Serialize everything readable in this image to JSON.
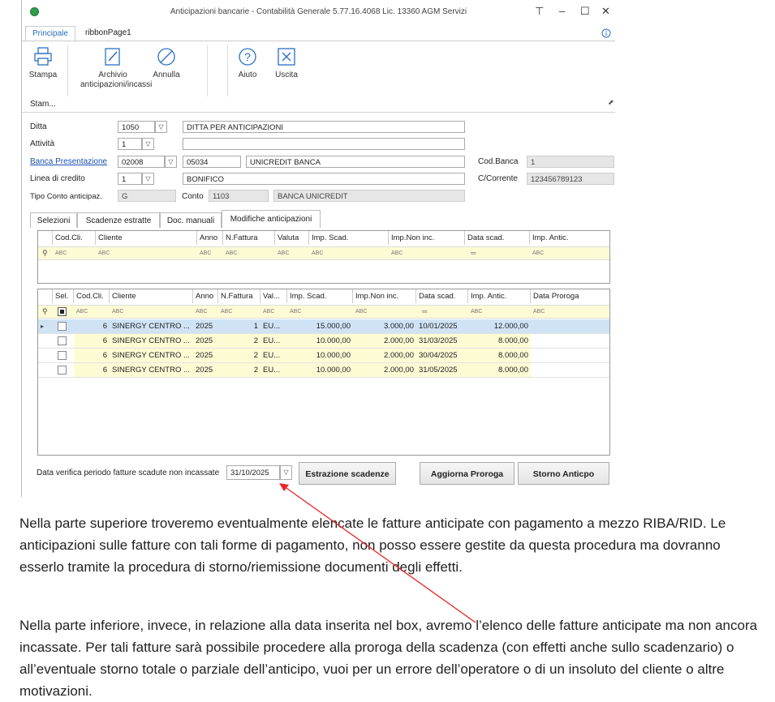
{
  "window": {
    "title": "Anticipazioni bancarie - Contabilità Generale 5.77.16.4068 Lic. 13360 AGM Servizi"
  },
  "ribbon": {
    "tabs": [
      {
        "label": "Principale"
      },
      {
        "label": "ribbonPage1"
      }
    ],
    "buttons": {
      "stampa": "Stampa",
      "archivio": "Archivio anticipazioni/incassi",
      "annulla": "Annulla",
      "aiuto": "Aiuto",
      "uscita": "Uscita"
    },
    "group_label": "Stam..."
  },
  "form": {
    "ditta": {
      "label": "Ditta",
      "code": "1050",
      "name": "DITTA PER ANTICIPAZIONI"
    },
    "attivita": {
      "label": "Attività",
      "value": "1"
    },
    "banca": {
      "label": "Banca Presentazione",
      "code": "02008",
      "cab": "05034",
      "name": "UNICREDIT BANCA"
    },
    "cod_banca": {
      "label": "Cod.Banca",
      "value": "1"
    },
    "linea": {
      "label": "Linea di credito",
      "value": "1",
      "desc": "BONIFICO"
    },
    "c_corrente": {
      "label": "C/Corrente",
      "value": "123456789123"
    },
    "tipo_conto": {
      "label": "Tipo Conto anticipaz.",
      "value": "G"
    },
    "conto": {
      "label": "Conto",
      "code": "1103",
      "desc": "BANCA UNICREDIT"
    }
  },
  "panel_tabs": [
    {
      "label": "Selezioni"
    },
    {
      "label": "Scadenze estratte"
    },
    {
      "label": "Doc. manuali"
    },
    {
      "label": "Modifiche anticipazioni"
    }
  ],
  "filter_glyph": "ABC",
  "top_grid": {
    "columns": [
      "Cod.Cli.",
      "Cliente",
      "Anno",
      "N.Fattura",
      "Valuta",
      "Imp. Scad.",
      "Imp.Non inc.",
      "Data scad.",
      "Imp. Antic."
    ]
  },
  "bottom_grid": {
    "columns": [
      "Sel.",
      "Cod.Cli.",
      "Cliente",
      "Anno",
      "N.Fattura",
      "Val...",
      "Imp. Scad.",
      "Imp.Non inc.",
      "Data scad.",
      "Imp. Antic.",
      "Data Proroga"
    ],
    "rows": [
      {
        "cod": "6",
        "cliente": "SINERGY CENTRO ...",
        "anno": "2025",
        "nfatt": "1",
        "val": "EU...",
        "imp": "15.000,00",
        "nonInc": "3.000,00",
        "data": "10/01/2025",
        "antic": "12.000,00",
        "proroga": ""
      },
      {
        "cod": "6",
        "cliente": "SINERGY CENTRO ...",
        "anno": "2025",
        "nfatt": "2",
        "val": "EU...",
        "imp": "10.000,00",
        "nonInc": "2.000,00",
        "data": "31/03/2025",
        "antic": "8.000,00",
        "proroga": ""
      },
      {
        "cod": "6",
        "cliente": "SINERGY CENTRO ...",
        "anno": "2025",
        "nfatt": "2",
        "val": "EU...",
        "imp": "10.000,00",
        "nonInc": "2.000,00",
        "data": "30/04/2025",
        "antic": "8.000,00",
        "proroga": ""
      },
      {
        "cod": "6",
        "cliente": "SINERGY CENTRO ...",
        "anno": "2025",
        "nfatt": "2",
        "val": "EU...",
        "imp": "10.000,00",
        "nonInc": "2.000,00",
        "data": "31/05/2025",
        "antic": "8.000,00",
        "proroga": ""
      }
    ]
  },
  "footer": {
    "label": "Data verifica periodo fatture scadute non incassate",
    "date": "31/10/2025",
    "estrazione": "Estrazione scadenze",
    "aggiorna": "Aggiorna Proroga",
    "storno": "Storno Anticpo"
  },
  "doc": {
    "p1": "Nella parte superiore troveremo eventualmente elencate le fatture anticipate con pagamento a mezzo RIBA/RID. Le anticipazioni sulle fatture con tali forme di pagamento, non posso essere gestite da questa procedura ma dovranno esserlo tramite la procedura di storno/riemissione documenti degli effetti.",
    "p2": "Nella parte inferiore, invece, in relazione alla data inserita nel box, avremo l’elenco delle fatture anticipate ma non ancora incassate. Per tali fatture sarà possibile procedere alla proroga della scadenza (con effetti anche sullo scadenzario) o all’eventuale storno totale o parziale dell’anticipo, vuoi per un errore dell’operatore o di un insoluto del cliente o altre motivazioni."
  },
  "colors": {
    "accent": "#2a6fc2",
    "selected_row": "#cfe3f5",
    "filter_row": "#fdfbd4",
    "arrow": "#e8262a"
  }
}
